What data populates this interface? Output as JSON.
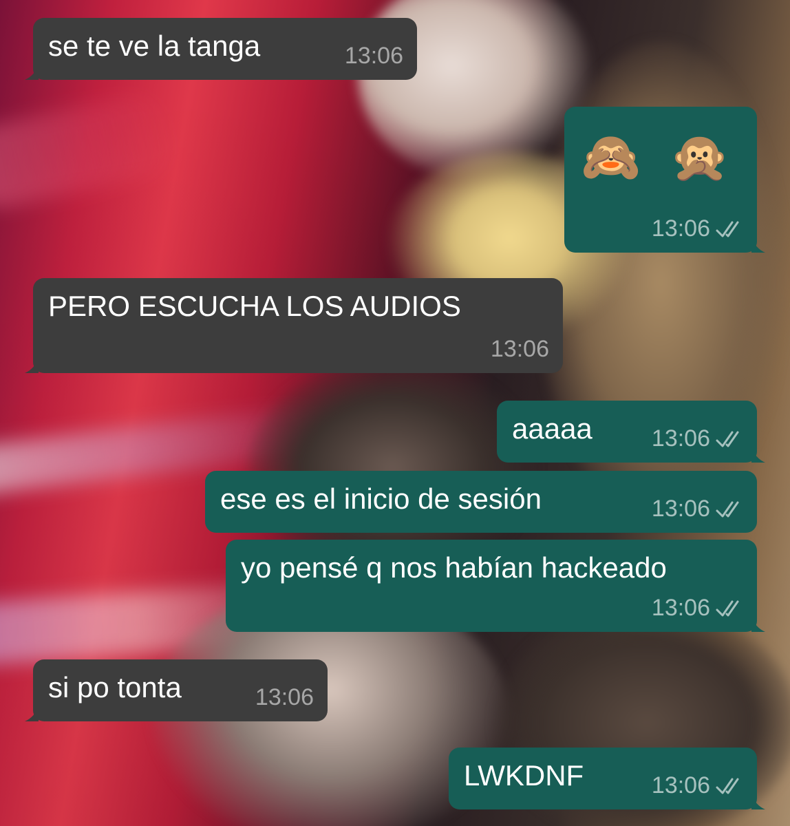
{
  "messages": [
    {
      "side": "in",
      "text": "se te ve la tanga",
      "time": "13:06"
    },
    {
      "side": "out",
      "emoji": "🙈 🙊",
      "emoji_names": [
        "see-no-evil-monkey-icon",
        "speak-no-evil-monkey-icon"
      ],
      "time": "13:06",
      "status": "read"
    },
    {
      "side": "in",
      "text": "PERO ESCUCHA LOS AUDIOS",
      "time": "13:06"
    },
    {
      "side": "out",
      "text": "aaaaa",
      "time": "13:06",
      "status": "read"
    },
    {
      "side": "out",
      "text": "ese es el inicio de sesión",
      "time": "13:06",
      "status": "read"
    },
    {
      "side": "out",
      "text": "yo pensé q nos habían hackeado",
      "time": "13:06",
      "status": "read"
    },
    {
      "side": "in",
      "text": "si po tonta",
      "time": "13:06"
    },
    {
      "side": "out",
      "text": "LWKDNF",
      "time": "13:06",
      "status": "read"
    }
  ],
  "colors": {
    "incoming_bubble": "#3d3d3d",
    "outgoing_bubble": "#175e56",
    "text": "#ffffff",
    "meta_text": "#b9c6c2"
  },
  "icons": {
    "read_receipt": "double-check-icon",
    "wallpaper": "concert-photo-wallpaper"
  }
}
